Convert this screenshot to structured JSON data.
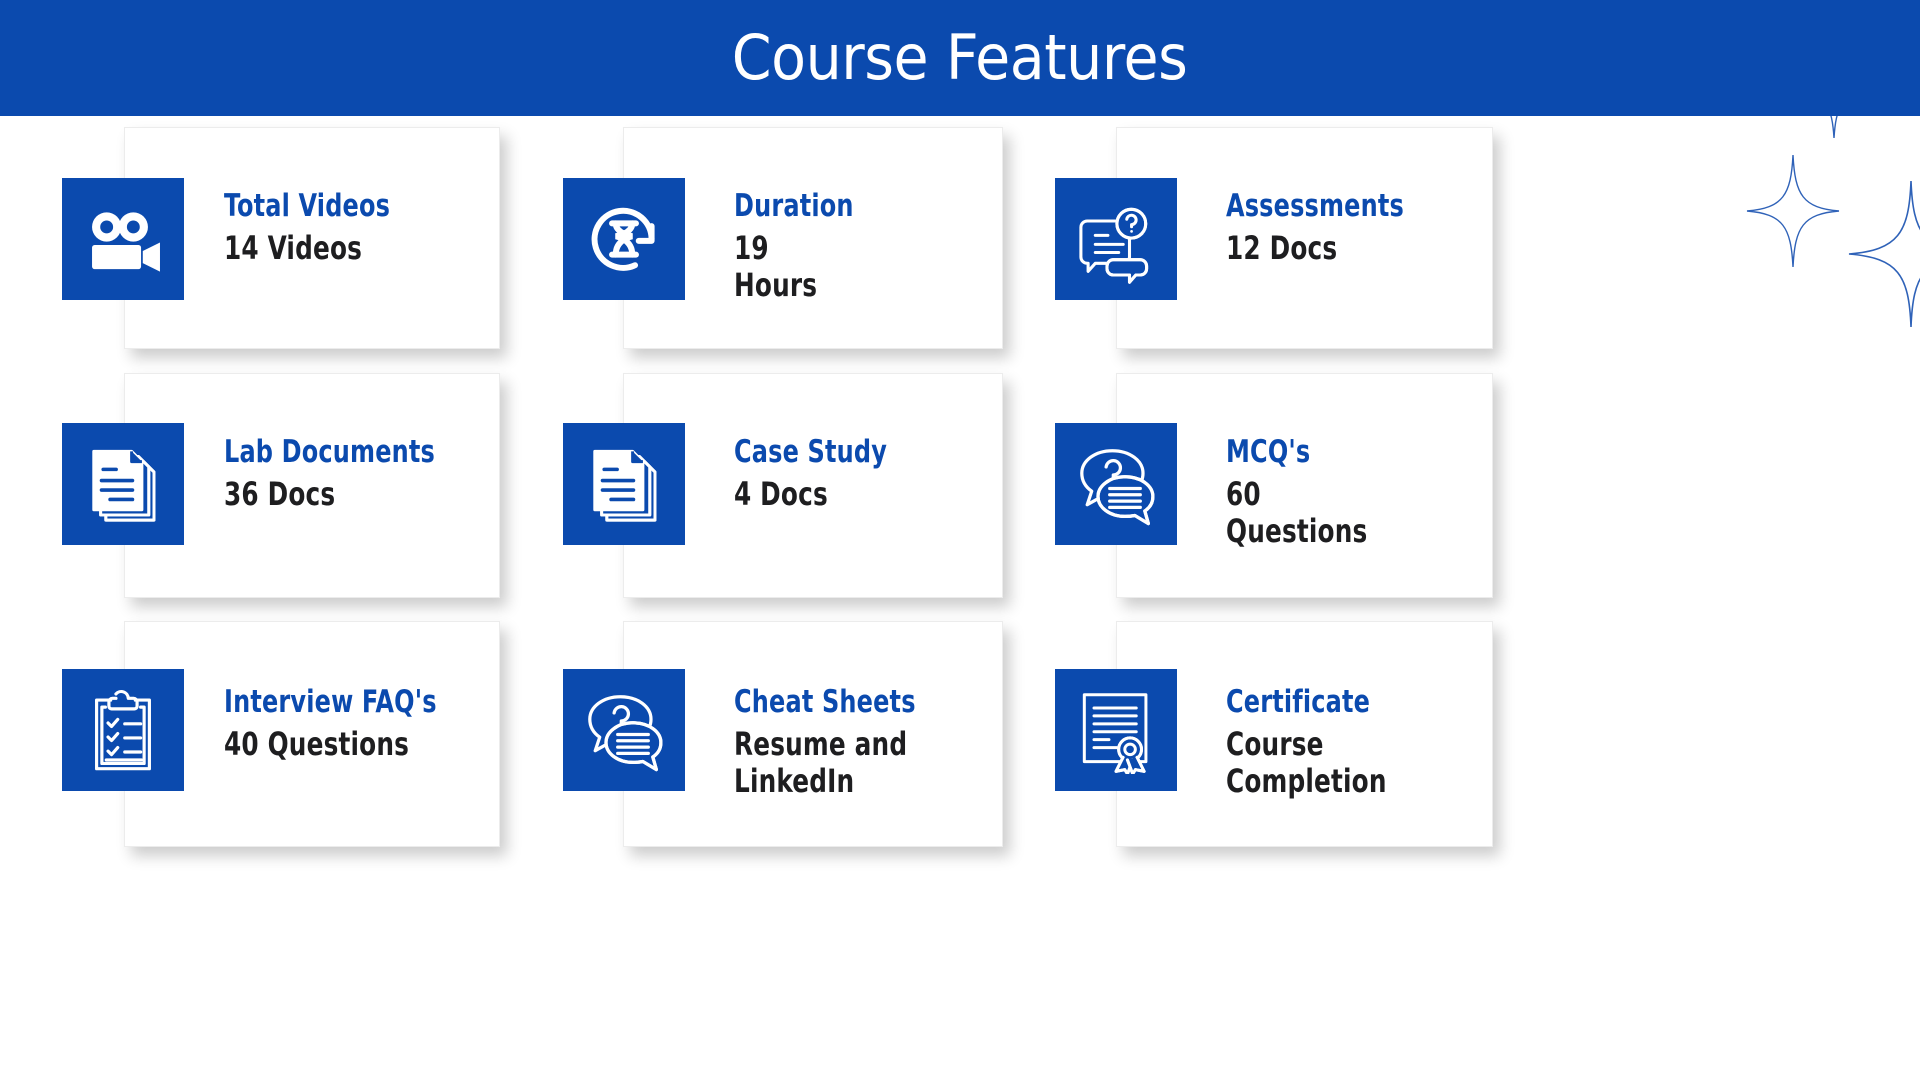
{
  "header": {
    "title": "Course Features",
    "background_color": "#0B4AAE",
    "text_color": "#FFFFFF"
  },
  "theme": {
    "accent_blue": "#0B4AAE",
    "title_blue": "#0B4AAE",
    "value_dark": "#1E1E20",
    "card_background": "#FFFFFF",
    "page_background": "#FFFFFF"
  },
  "decorations": [
    {
      "name": "sparkle-top",
      "color": "#2F62B8"
    },
    {
      "name": "sparkle-small",
      "color": "#2F62B8"
    },
    {
      "name": "sparkle-large",
      "color": "#2F62B8"
    }
  ],
  "cards": [
    {
      "icon": "video-camera-icon",
      "title": "Total Videos",
      "value": "14 Videos"
    },
    {
      "icon": "hourglass-refresh-icon",
      "title": "Duration",
      "value": "19 Hours"
    },
    {
      "icon": "assessment-question-icon",
      "title": "Assessments",
      "value": "12 Docs"
    },
    {
      "icon": "documents-stack-icon",
      "title": "Lab Documents",
      "value": "36 Docs"
    },
    {
      "icon": "documents-stack-icon",
      "title": "Case Study",
      "value": "4 Docs"
    },
    {
      "icon": "chat-question-icon",
      "title": "MCQ's",
      "value": "60 Questions"
    },
    {
      "icon": "clipboard-checklist-icon",
      "title": "Interview FAQ's",
      "value": "40 Questions"
    },
    {
      "icon": "chat-question-icon",
      "title": "Cheat Sheets",
      "value": "Resume and\nLinkedIn"
    },
    {
      "icon": "certificate-award-icon",
      "title": "Certificate",
      "value": "Course Completion"
    }
  ]
}
